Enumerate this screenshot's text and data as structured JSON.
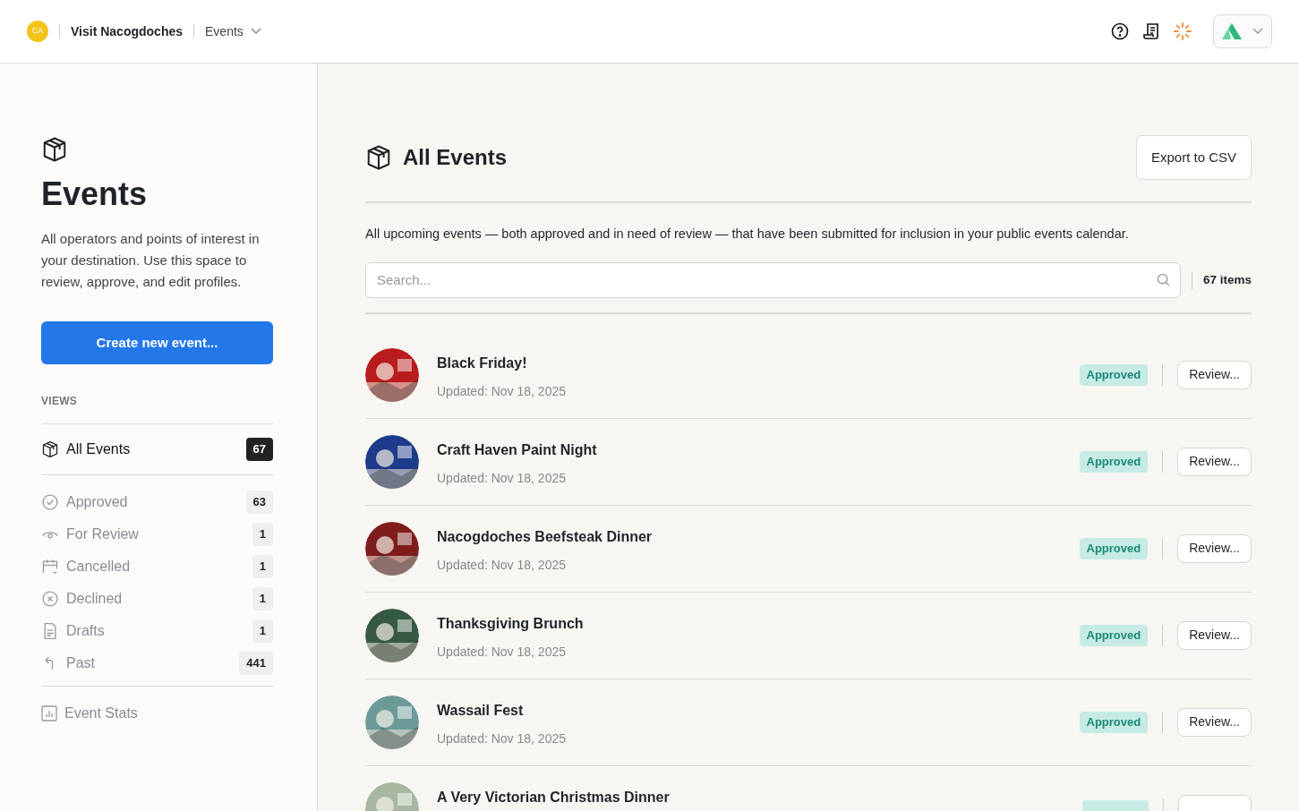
{
  "header": {
    "avatar": "CA",
    "org": "Visit Nacogdoches",
    "section": "Events"
  },
  "sidebar": {
    "title": "Events",
    "description": "All operators and points of interest in your destination. Use this space to review, approve, and edit profiles.",
    "create_button": "Create new event...",
    "views_label": "VIEWS",
    "items": [
      {
        "kind": "all",
        "label": "All Events",
        "count": "67",
        "selected": true
      },
      {
        "kind": "approved",
        "label": "Approved",
        "count": "63",
        "selected": false
      },
      {
        "kind": "review",
        "label": "For Review",
        "count": "1",
        "selected": false
      },
      {
        "kind": "cancelled",
        "label": "Cancelled",
        "count": "1",
        "selected": false
      },
      {
        "kind": "declined",
        "label": "Declined",
        "count": "1",
        "selected": false
      },
      {
        "kind": "drafts",
        "label": "Drafts",
        "count": "1",
        "selected": false
      },
      {
        "kind": "past",
        "label": "Past",
        "count": "441",
        "selected": false
      }
    ],
    "stats": "Event Stats"
  },
  "main": {
    "title": "All Events",
    "export_button": "Export to CSV",
    "description": "All upcoming events —  both approved and in need of review — that have been submitted for inclusion in your public events calendar.",
    "search": {
      "placeholder": "Search..."
    },
    "count": "67 items",
    "events": [
      {
        "title": "Black Friday!",
        "updated": "Updated: Nov 18, 2025",
        "status": "Approved",
        "action": "Review..."
      },
      {
        "title": "Craft Haven Paint Night",
        "updated": "Updated: Nov 18, 2025",
        "status": "Approved",
        "action": "Review..."
      },
      {
        "title": "Nacogdoches Beefsteak Dinner",
        "updated": "Updated: Nov 18, 2025",
        "status": "Approved",
        "action": "Review..."
      },
      {
        "title": "Thanksgiving Brunch",
        "updated": "Updated: Nov 18, 2025",
        "status": "Approved",
        "action": "Review..."
      },
      {
        "title": "Wassail Fest",
        "updated": "Updated: Nov 18, 2025",
        "status": "Approved",
        "action": "Review..."
      },
      {
        "title": "A Very Victorian Christmas Dinner"
      }
    ]
  }
}
